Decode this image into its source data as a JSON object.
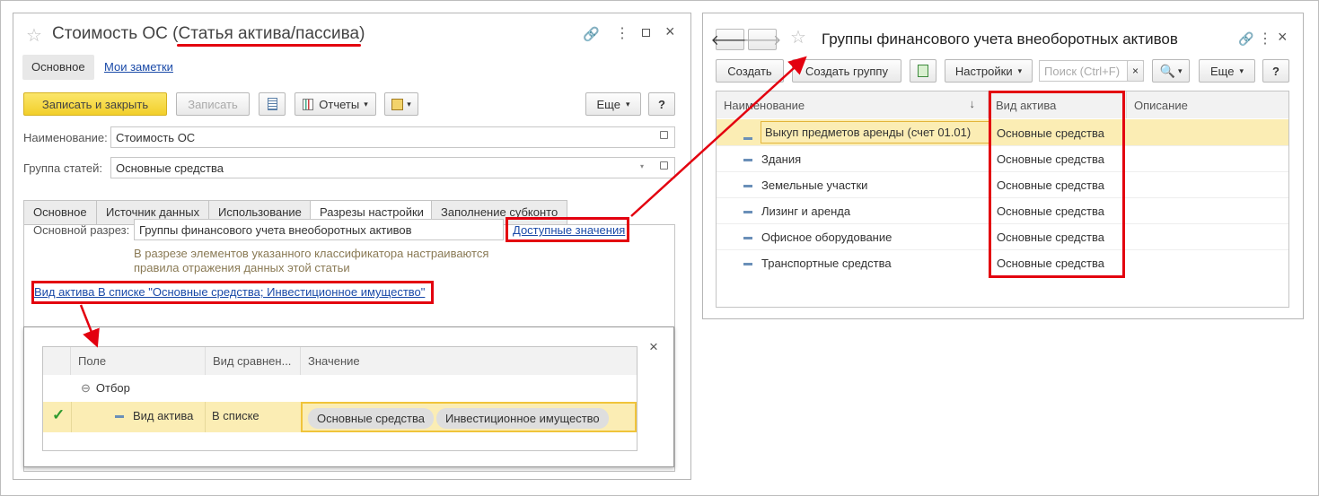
{
  "left_window": {
    "title_prefix": "Стоимость ОС (",
    "title_highlight": "Статья актива/пассива",
    "title_suffix": ")",
    "nav_tabs": [
      "Основное",
      "Мои заметки"
    ],
    "toolbar": {
      "save_close": "Записать и закрыть",
      "save": "Записать",
      "reports": "Отчеты",
      "more": "Еще",
      "help": "?"
    },
    "name_label": "Наименование:",
    "name_value": "Стоимость ОС",
    "group_label": "Группа статей:",
    "group_value": "Основные средства",
    "tabs": [
      "Основное",
      "Источник данных",
      "Использование",
      "Разрезы настройки",
      "Заполнение субконто"
    ],
    "main_section_label": "Основной разрез:",
    "main_section_value": "Группы финансового учета внеоборотных активов",
    "available_values_link": "Доступные значения",
    "hint_line1": "В разрезе элементов указанного классификатора настраиваются",
    "hint_line2": "правила отражения данных этой статьи",
    "filter_link": "Вид актива В списке \"Основные средства; Инвестиционное имущество\""
  },
  "filter_popup": {
    "columns": [
      "Поле",
      "Вид сравнен...",
      "Значение"
    ],
    "group_label": "Отбор",
    "row": {
      "field": "Вид актива",
      "comparison": "В списке",
      "values": [
        "Основные средства",
        "Инвестиционное имущество"
      ]
    }
  },
  "right_window": {
    "title": "Группы финансового учета внеоборотных активов",
    "toolbar": {
      "create": "Создать",
      "create_group": "Создать группу",
      "settings": "Настройки",
      "search_placeholder": "Поиск (Ctrl+F)",
      "more": "Еще",
      "help": "?"
    },
    "columns": [
      "Наименование",
      "Вид актива",
      "Описание"
    ],
    "rows": [
      {
        "name": "Выкуп предметов аренды (счет 01.01)",
        "kind": "Основные средства"
      },
      {
        "name": "Здания",
        "kind": "Основные средства"
      },
      {
        "name": "Земельные участки",
        "kind": "Основные средства"
      },
      {
        "name": "Лизинг и аренда",
        "kind": "Основные средства"
      },
      {
        "name": "Офисное оборудование",
        "kind": "Основные средства"
      },
      {
        "name": "Транспортные средства",
        "kind": "Основные средства"
      }
    ]
  },
  "colors": {
    "accent_red": "#e3000f",
    "selected_row": "#fbedb4",
    "yellow_button": "#f2cf2a"
  }
}
